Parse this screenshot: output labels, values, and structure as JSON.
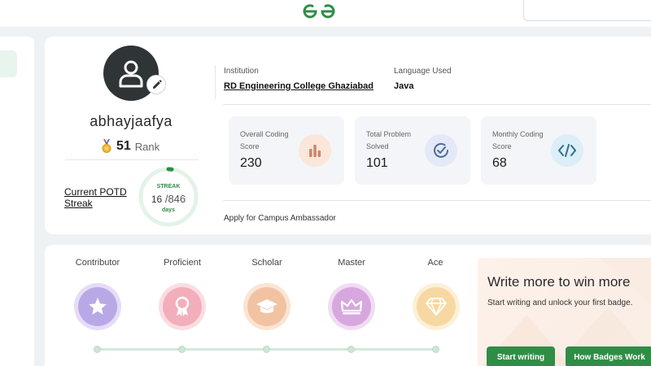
{
  "profile": {
    "username": "abhayjaafya",
    "rank_value": "51",
    "rank_label": "Rank"
  },
  "potd": {
    "label_line1": "Current POTD",
    "label_line2": "Streak",
    "streak_title": "STREAK",
    "current": "16",
    "total": "/846",
    "unit": "days",
    "progress_fraction": 0.019
  },
  "info": {
    "institution_label": "Institution",
    "institution_value": "RD Engineering College Ghaziabad",
    "language_label": "Language Used",
    "language_value": "Java"
  },
  "stats": [
    {
      "label": "Overall Coding Score",
      "value": "230",
      "icon": "bar-chart-icon",
      "icon_bg": "#fbe6da",
      "icon_color": "#c9876a"
    },
    {
      "label": "Total Problem Solved",
      "value": "101",
      "icon": "check-circle-icon",
      "icon_bg": "#e3e9f6",
      "icon_color": "#4f6b9c"
    },
    {
      "label": "Monthly Coding Score",
      "value": "68",
      "icon": "code-icon",
      "icon_bg": "#dceef7",
      "icon_color": "#2f6f94"
    }
  ],
  "apply_link": "Apply for Campus Ambassador",
  "badges": [
    {
      "name": "Contributor",
      "icon": "star-icon",
      "outer": "#e6dcf6",
      "inner": "#b9a8e6"
    },
    {
      "name": "Proficient",
      "icon": "rosette-icon",
      "outer": "#fadde2",
      "inner": "#f3aebb"
    },
    {
      "name": "Scholar",
      "icon": "graduation-cap-icon",
      "outer": "#fbe4d4",
      "inner": "#f2c3a3"
    },
    {
      "name": "Master",
      "icon": "crown-icon",
      "outer": "#f1dcf3",
      "inner": "#d7a8de"
    },
    {
      "name": "Ace",
      "icon": "diamond-icon",
      "outer": "#fdf0d8",
      "inner": "#f7d8a3"
    }
  ],
  "promo": {
    "title": "Write more to win more",
    "subtitle": "Start writing and unlock your first badge.",
    "start_button": "Start writing",
    "how_button": "How Badges Work"
  },
  "colors": {
    "brand_green": "#2f8d46",
    "page_bg": "#eef2f5",
    "card_bg": "#ffffff"
  }
}
